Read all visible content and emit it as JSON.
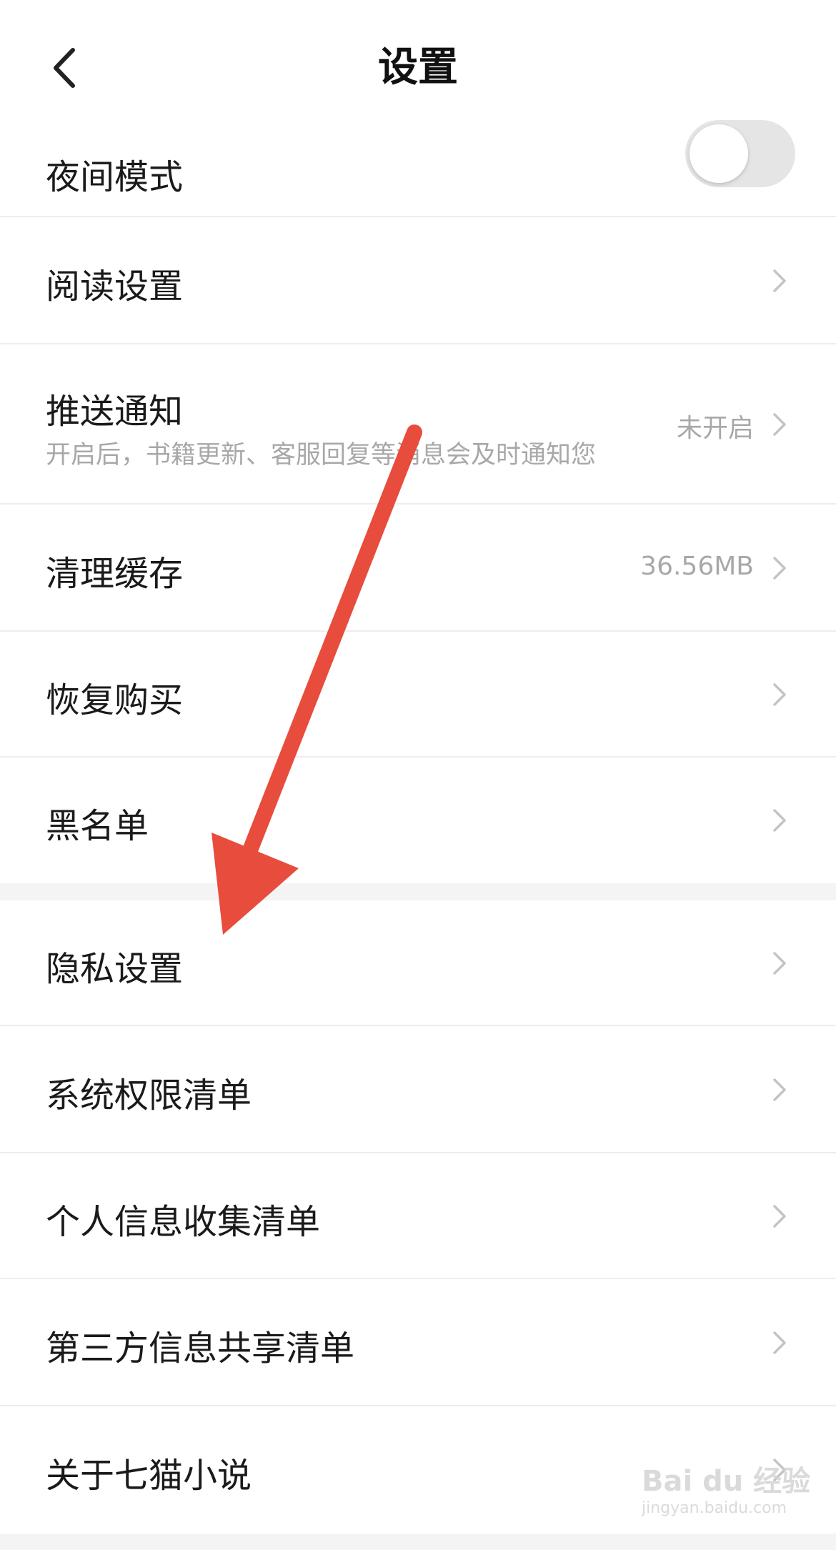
{
  "header": {
    "title": "设置"
  },
  "night_mode": {
    "label": "夜间模式",
    "enabled": false
  },
  "items": [
    {
      "label": "阅读设置"
    },
    {
      "label": "推送通知",
      "description": "开启后，书籍更新、客服回复等消息会及时通知您",
      "value": "未开启"
    },
    {
      "label": "清理缓存",
      "value": "36.56MB"
    },
    {
      "label": "恢复购买"
    },
    {
      "label": "黑名单"
    },
    {
      "label": "隐私设置"
    },
    {
      "label": "系统权限清单"
    },
    {
      "label": "个人信息收集清单"
    },
    {
      "label": "第三方信息共享清单"
    },
    {
      "label": "关于七猫小说"
    }
  ],
  "annotation": {
    "arrow_color": "#e84c3d"
  },
  "watermark": {
    "main": "Bai du 经验",
    "sub": "jingyan.baidu.com"
  },
  "colors": {
    "background": "#ffffff",
    "divider": "#ededed",
    "section_gap": "#f4f4f4",
    "secondary_text": "#a8a8a8",
    "toggle_off": "#e5e5e5"
  }
}
